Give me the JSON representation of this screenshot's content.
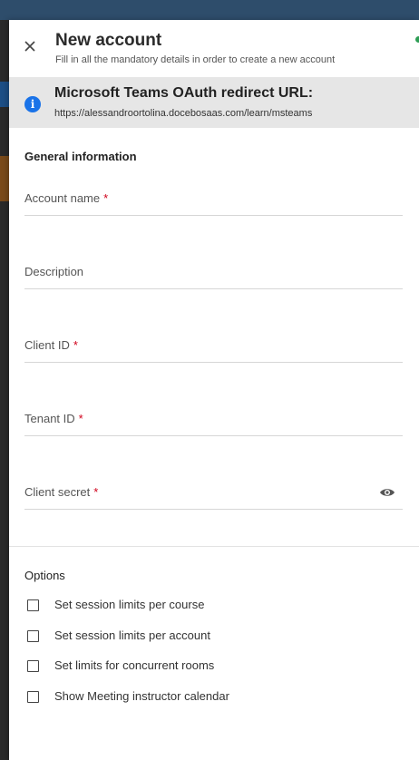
{
  "header": {
    "title": "New account",
    "subtitle": "Fill in all the mandatory details in order to create a new account"
  },
  "info_banner": {
    "title": "Microsoft Teams OAuth redirect URL:",
    "url": "https://alessandroortolina.docebosaas.com/learn/msteams",
    "icon": "info-icon",
    "icon_color": "#1a73e8"
  },
  "general": {
    "title": "General information",
    "fields": [
      {
        "label": "Account name",
        "required": "*"
      },
      {
        "label": "Description",
        "required": ""
      },
      {
        "label": "Client ID",
        "required": "*"
      },
      {
        "label": "Tenant ID",
        "required": "*"
      },
      {
        "label": "Client secret",
        "required": "*"
      }
    ]
  },
  "options": {
    "title": "Options",
    "items": [
      {
        "label": "Set session limits per course",
        "checked": false
      },
      {
        "label": "Set session limits per account",
        "checked": false
      },
      {
        "label": "Set limits for concurrent rooms",
        "checked": false
      },
      {
        "label": "Show Meeting instructor calendar",
        "checked": false
      }
    ]
  },
  "colors": {
    "required": "#d0021b",
    "topbar": "#2e4d6b",
    "banner_bg": "#e6e6e6"
  }
}
